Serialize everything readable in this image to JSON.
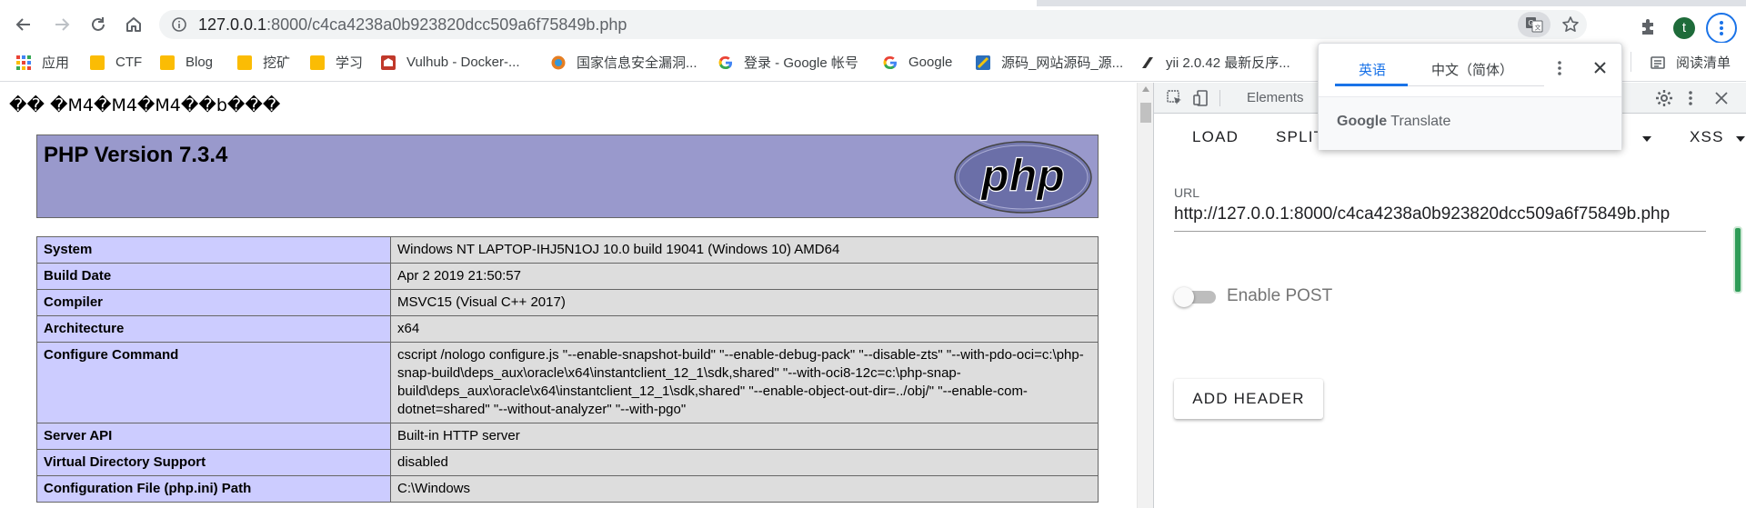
{
  "browser": {
    "url_prefix": "127.0.0.1",
    "url_rest": ":8000/c4ca4238a0b923820dcc509a6f75849b.php",
    "profile_initial": "t",
    "profile_color": "#1e6b3a",
    "accent_color": "#1a73e8"
  },
  "bookmarks": [
    {
      "label": "应用",
      "icon": "apps-grid-icon"
    },
    {
      "label": "CTF",
      "icon": "folder-icon"
    },
    {
      "label": "Blog",
      "icon": "folder-icon"
    },
    {
      "label": "挖矿",
      "icon": "folder-icon"
    },
    {
      "label": "学习",
      "icon": "folder-icon"
    },
    {
      "label": "Vulhub - Docker-...",
      "icon": "vulhub-icon"
    },
    {
      "label": "国家信息安全漏洞...",
      "icon": "cnnvd-icon"
    },
    {
      "label": "登录 - Google 帐号",
      "icon": "google-icon"
    },
    {
      "label": "Google",
      "icon": "google-icon"
    },
    {
      "label": "源码_网站源码_源...",
      "icon": "source-site-icon"
    },
    {
      "label": "yii 2.0.42 最新反序...",
      "icon": "yii-icon"
    },
    {
      "label": "阅读清单",
      "icon": "reading-list-icon"
    }
  ],
  "page": {
    "garbled_text": "�� �M4�M4�M4��b���",
    "php_version_title": "PHP Version 7.3.4",
    "php_logo_text": "php",
    "info_rows": [
      {
        "key": "System",
        "value": "Windows NT LAPTOP-IHJ5N1OJ 10.0 build 19041 (Windows 10) AMD64"
      },
      {
        "key": "Build Date",
        "value": "Apr 2 2019 21:50:57"
      },
      {
        "key": "Compiler",
        "value": "MSVC15 (Visual C++ 2017)"
      },
      {
        "key": "Architecture",
        "value": "x64"
      },
      {
        "key": "Configure Command",
        "value": "cscript /nologo configure.js \"--enable-snapshot-build\" \"--enable-debug-pack\" \"--disable-zts\" \"--with-pdo-oci=c:\\php-snap-build\\deps_aux\\oracle\\x64\\instantclient_12_1\\sdk,shared\" \"--with-oci8-12c=c:\\php-snap-build\\deps_aux\\oracle\\x64\\instantclient_12_1\\sdk,shared\" \"--enable-object-out-dir=../obj/\" \"--enable-com-dotnet=shared\" \"--without-analyzer\" \"--with-pgo\""
      },
      {
        "key": "Server API",
        "value": "Built-in HTTP server"
      },
      {
        "key": "Virtual Directory Support",
        "value": "disabled"
      },
      {
        "key": "Configuration File (php.ini) Path",
        "value": "C:\\Windows"
      }
    ]
  },
  "devtools": {
    "elements_tab": "Elements",
    "hackbar_tabs": {
      "load": "LOAD",
      "split": "SPLIT",
      "xss": "XSS"
    },
    "url_label": "URL",
    "url_value": "http://127.0.0.1:8000/c4ca4238a0b923820dcc509a6f75849b.php",
    "enable_post_label": "Enable POST",
    "enable_post_on": false,
    "add_header_label": "ADD HEADER"
  },
  "translate_popup": {
    "source_lang": "英语",
    "target_lang": "中文（简体）",
    "footer_brand": "Google",
    "footer_word": "Translate"
  }
}
